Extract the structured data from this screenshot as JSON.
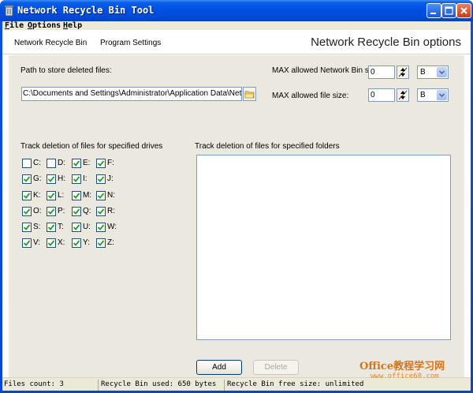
{
  "window": {
    "title": "Network Recycle Bin Tool"
  },
  "menu": [
    {
      "label": "File",
      "key": "F",
      "rest": "ile"
    },
    {
      "label": "Options",
      "key": "O",
      "rest": "ptions"
    },
    {
      "label": "Help",
      "key": "H",
      "rest": "elp"
    }
  ],
  "nav": {
    "tab_network_bin": "Network Recycle Bin",
    "tab_program_settings": "Program Settings",
    "title": "Network Recycle Bin options"
  },
  "path": {
    "label": "Path to store deleted files:",
    "value": "C:\\Documents and Settings\\Administrator\\Application Data\\NetRecycle"
  },
  "max_bin": {
    "label": "MAX allowed Network Bin size:",
    "value": "0",
    "unit": "B"
  },
  "max_file": {
    "label": "MAX allowed file size:",
    "value": "0",
    "unit": "B"
  },
  "drives": {
    "label": "Track deletion of files for specified drives",
    "items": [
      {
        "letter": "C:",
        "checked": false
      },
      {
        "letter": "D:",
        "checked": false
      },
      {
        "letter": "E:",
        "checked": true
      },
      {
        "letter": "F:",
        "checked": true
      },
      {
        "letter": "G:",
        "checked": true
      },
      {
        "letter": "H:",
        "checked": true
      },
      {
        "letter": "I:",
        "checked": true
      },
      {
        "letter": "J:",
        "checked": true
      },
      {
        "letter": "K:",
        "checked": true
      },
      {
        "letter": "L:",
        "checked": true
      },
      {
        "letter": "M:",
        "checked": true
      },
      {
        "letter": "N:",
        "checked": true
      },
      {
        "letter": "O:",
        "checked": true
      },
      {
        "letter": "P:",
        "checked": true
      },
      {
        "letter": "Q:",
        "checked": true
      },
      {
        "letter": "R:",
        "checked": true
      },
      {
        "letter": "S:",
        "checked": true
      },
      {
        "letter": "T:",
        "checked": true
      },
      {
        "letter": "U:",
        "checked": true
      },
      {
        "letter": "W:",
        "checked": true
      },
      {
        "letter": "V:",
        "checked": true
      },
      {
        "letter": "X:",
        "checked": true
      },
      {
        "letter": "Y:",
        "checked": true
      },
      {
        "letter": "Z:",
        "checked": true
      }
    ]
  },
  "folders": {
    "label": "Track deletion of files for specified folders"
  },
  "buttons": {
    "add": "Add",
    "delete": "Delete"
  },
  "status": {
    "files_count": "Files count: 3",
    "bin_used": "Recycle Bin used: 650 bytes",
    "bin_free": "Recycle Bin free size: unlimited"
  },
  "watermark": {
    "brand": "Office教程学习网",
    "url": "www.office68.com"
  },
  "colors": {
    "titlebar": "#0050e3",
    "panel": "#ebe9df",
    "check": "#21a121"
  }
}
